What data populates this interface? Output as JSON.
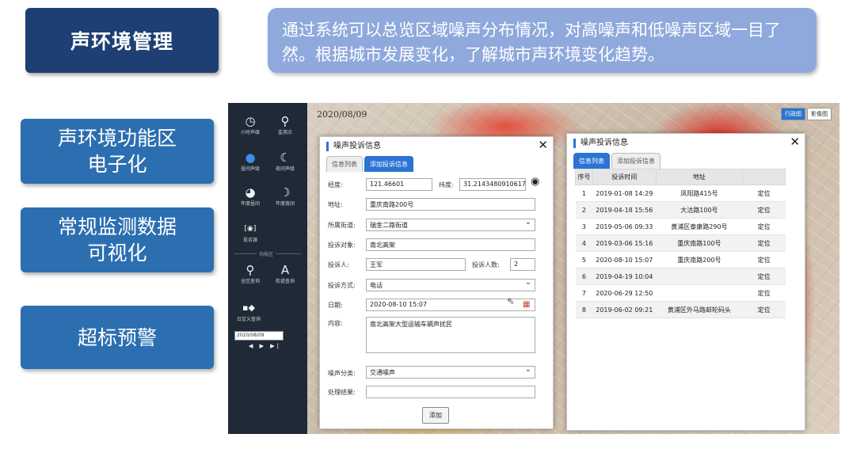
{
  "header": {
    "title": "声环境管理",
    "description": "通过系统可以总览区域噪声分布情况，对高噪声和低噪声区域一目了然。根据城市发展变化，了解城市声环境变化趋势。"
  },
  "features": [
    {
      "line1": "声环境功能区",
      "line2": "电子化"
    },
    {
      "line1": "常规监测数据",
      "line2": "可视化"
    },
    {
      "line1": "超标预警",
      "line2": ""
    }
  ],
  "app": {
    "map_date": "2020/08/09",
    "map_layers": [
      "行政图",
      "影像图"
    ],
    "sidebar": {
      "items": [
        {
          "label": "小时声级",
          "icon": "clock-icon"
        },
        {
          "label": "监测点",
          "icon": "location-pin-icon"
        },
        {
          "label": "昼间声级",
          "icon": "sun-icon"
        },
        {
          "label": "夜间声级",
          "icon": "moon-icon"
        },
        {
          "label": "年度昼间",
          "icon": "calendar-day-icon"
        },
        {
          "label": "年度夜间",
          "icon": "calendar-night-icon"
        },
        {
          "label": "投诉源",
          "icon": "complaint-source-icon"
        },
        {
          "label": "全区查询",
          "icon": "area-search-icon"
        },
        {
          "label": "街道查询",
          "icon": "street-search-icon"
        },
        {
          "label": "日定义查询",
          "icon": "custom-query-icon"
        }
      ],
      "divider_label": "功能区",
      "date_value": "2020/08/09",
      "play_controls": "◀ ▶ ▶|"
    },
    "form_dialog": {
      "title": "噪声投诉信息",
      "tabs": [
        "信息列表",
        "添加投诉信息"
      ],
      "fields": {
        "longitude_label": "经度:",
        "longitude_value": "121.46601",
        "latitude_label": "纬度:",
        "latitude_value": "31.2143480910617",
        "address_label": "地址:",
        "address_value": "重庆南路200号",
        "street_label": "所属街道:",
        "street_value": "瑞金二路街道",
        "target_label": "投诉对象:",
        "target_value": "南北高架",
        "complainant_label": "投诉人:",
        "complainant_value": "王军",
        "count_label": "投诉人数:",
        "count_value": "2",
        "method_label": "投诉方式:",
        "method_value": "电话",
        "date_label": "日期:",
        "date_value": "2020-08-10 15:07",
        "content_label": "内容:",
        "content_value": "南北高架大型运输车辆声扰民",
        "category_label": "噪声分类:",
        "category_value": "交通噪声",
        "result_label": "处理结果:",
        "result_value": ""
      },
      "submit_label": "添加"
    },
    "list_dialog": {
      "title": "噪声投诉信息",
      "tabs": [
        "信息列表",
        "添加投诉信息"
      ],
      "columns": [
        "序号",
        "投诉时间",
        "地址",
        ""
      ],
      "rows": [
        {
          "no": "1",
          "time": "2019-01-08 14:29",
          "address": "凤阳路415号",
          "action": "定位"
        },
        {
          "no": "2",
          "time": "2019-04-18 15:56",
          "address": "大沽路100号",
          "action": "定位"
        },
        {
          "no": "3",
          "time": "2019-05-06 09:33",
          "address": "黄浦区泰康路290号",
          "action": "定位"
        },
        {
          "no": "4",
          "time": "2019-03-06 15:16",
          "address": "重庆南路100号",
          "action": "定位"
        },
        {
          "no": "5",
          "time": "2020-08-10 15:07",
          "address": "重庆南路200号",
          "action": "定位"
        },
        {
          "no": "6",
          "time": "2019-04-19 10:04",
          "address": "",
          "action": "定位"
        },
        {
          "no": "7",
          "time": "2020-06-29 12:50",
          "address": "",
          "action": "定位"
        },
        {
          "no": "8",
          "time": "2019-06-02 09:21",
          "address": "黄浦区外马路邮轮码头",
          "action": "定位"
        }
      ]
    }
  },
  "colors": {
    "title_bg": "#1d3f73",
    "desc_bg": "#8fa9dc",
    "feature_bg": "#2c6fb1",
    "accent": "#2a74d3",
    "sidebar_bg": "#1f2a36"
  }
}
